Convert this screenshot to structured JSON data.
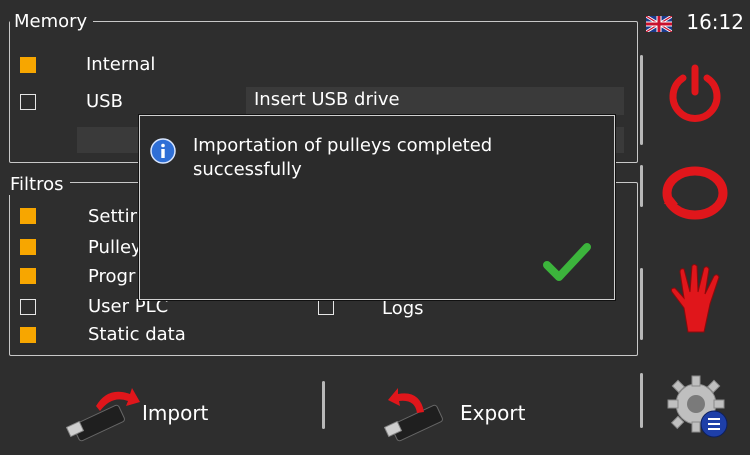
{
  "header": {
    "time": "16:12",
    "language_flag_icon": "uk-flag-icon"
  },
  "memory": {
    "title": "Memory",
    "options": [
      {
        "label": "Internal",
        "checked": true
      },
      {
        "label": "USB",
        "checked": false
      }
    ],
    "usb_status": "Insert USB drive"
  },
  "filters": {
    "title": "Filtros",
    "left_items": [
      {
        "label": "Settir",
        "checked": true
      },
      {
        "label": "Pulley",
        "checked": true
      },
      {
        "label": "Progr",
        "checked": true
      },
      {
        "label": "User PLC",
        "checked": false
      },
      {
        "label": "Static data",
        "checked": true
      }
    ],
    "right_items": [
      {
        "label": "Logs",
        "checked": false
      }
    ]
  },
  "dialog": {
    "message": "Importation of pulleys completed successfully",
    "icon": "info-icon",
    "confirm_icon": "checkmark-icon"
  },
  "actions": {
    "import_label": "Import",
    "export_label": "Export"
  },
  "side_buttons": [
    "power-icon",
    "refresh-icon",
    "hand-stop-icon",
    "settings-gear-icon"
  ],
  "colors": {
    "accent": "#f7a600",
    "background": "#2e2e2e",
    "danger": "#e0161b",
    "success": "#3cb43c"
  }
}
